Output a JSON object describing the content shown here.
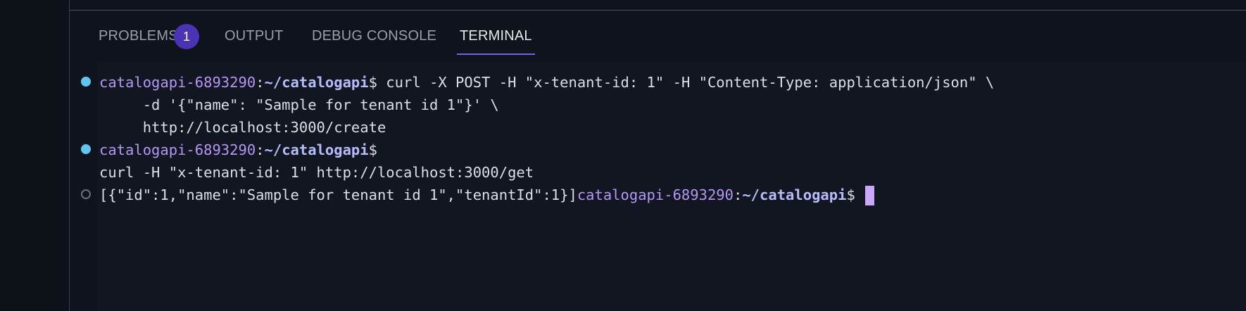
{
  "panel": {
    "tabs": [
      {
        "label": "PROBLEMS",
        "badge": "1"
      },
      {
        "label": "OUTPUT"
      },
      {
        "label": "DEBUG CONSOLE"
      },
      {
        "label": "TERMINAL",
        "active": true
      }
    ]
  },
  "terminal": {
    "prompt_host": "catalogapi-6893290",
    "prompt_sep": ":",
    "prompt_path": "~/catalogapi",
    "prompt_symbol": "$",
    "cmd1_part1": " curl -X POST -H \"x-tenant-id: 1\" -H \"Content-Type: application/json\" \\",
    "cmd1_part2": "     -d '{\"name\": \"Sample for tenant id 1\"}' \\",
    "cmd1_part3": "     http://localhost:3000/create",
    "cmd2": "curl -H \"x-tenant-id: 1\" http://localhost:3000/get",
    "output": "[{\"id\":1,\"name\":\"Sample for tenant id 1\",\"tenantId\":1}]"
  }
}
